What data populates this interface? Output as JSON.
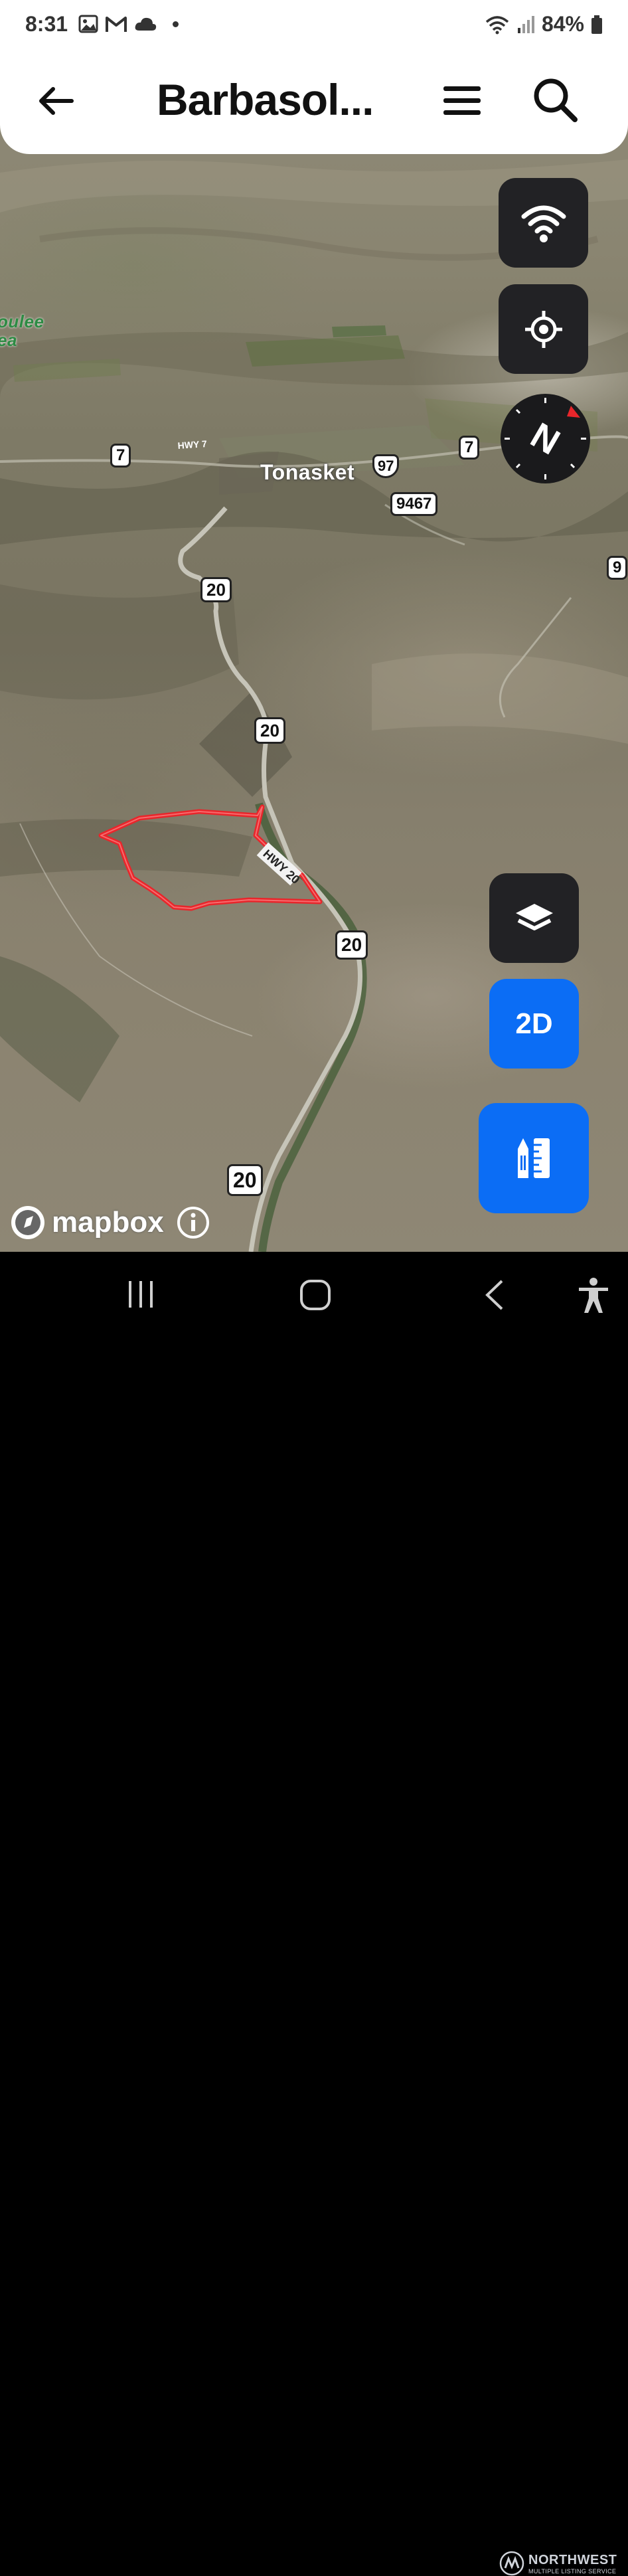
{
  "status_bar": {
    "time": "8:31",
    "battery": "84%"
  },
  "header": {
    "title": "Barbasol..."
  },
  "map": {
    "place_name": "Tonasket",
    "partial_place_lines": [
      "oulee",
      "ea"
    ],
    "shields": {
      "hwy7_left": "7",
      "hwy7_right": "7",
      "us97": "97",
      "r9467": "9467",
      "r9_edge": "9",
      "hwy20_a": "20",
      "hwy20_b": "20",
      "hwy20_c": "20",
      "hwy20_d": "20"
    },
    "road_labels": {
      "hwy7_text": "HWY 7",
      "hwy20_text": "HWY 20"
    }
  },
  "controls": {
    "mode_toggle": "2D"
  },
  "attribution": {
    "brand": "mapbox"
  },
  "watermark": {
    "brand": "NORTHWEST",
    "sub": "MULTIPLE LISTING SERVICE"
  },
  "colors": {
    "accent_blue": "#0b6df5",
    "button_dark": "#222225",
    "parcel_outline": "#e8262b"
  },
  "icons": [
    "back-arrow-icon",
    "hamburger-menu-icon",
    "search-icon",
    "wifi-icon",
    "crosshair-locate-icon",
    "compass-icon",
    "layers-icon",
    "ruler-pencil-icon",
    "info-icon",
    "mapbox-logo-icon",
    "nav-recents-icon",
    "nav-home-icon",
    "nav-back-icon",
    "accessibility-icon"
  ]
}
